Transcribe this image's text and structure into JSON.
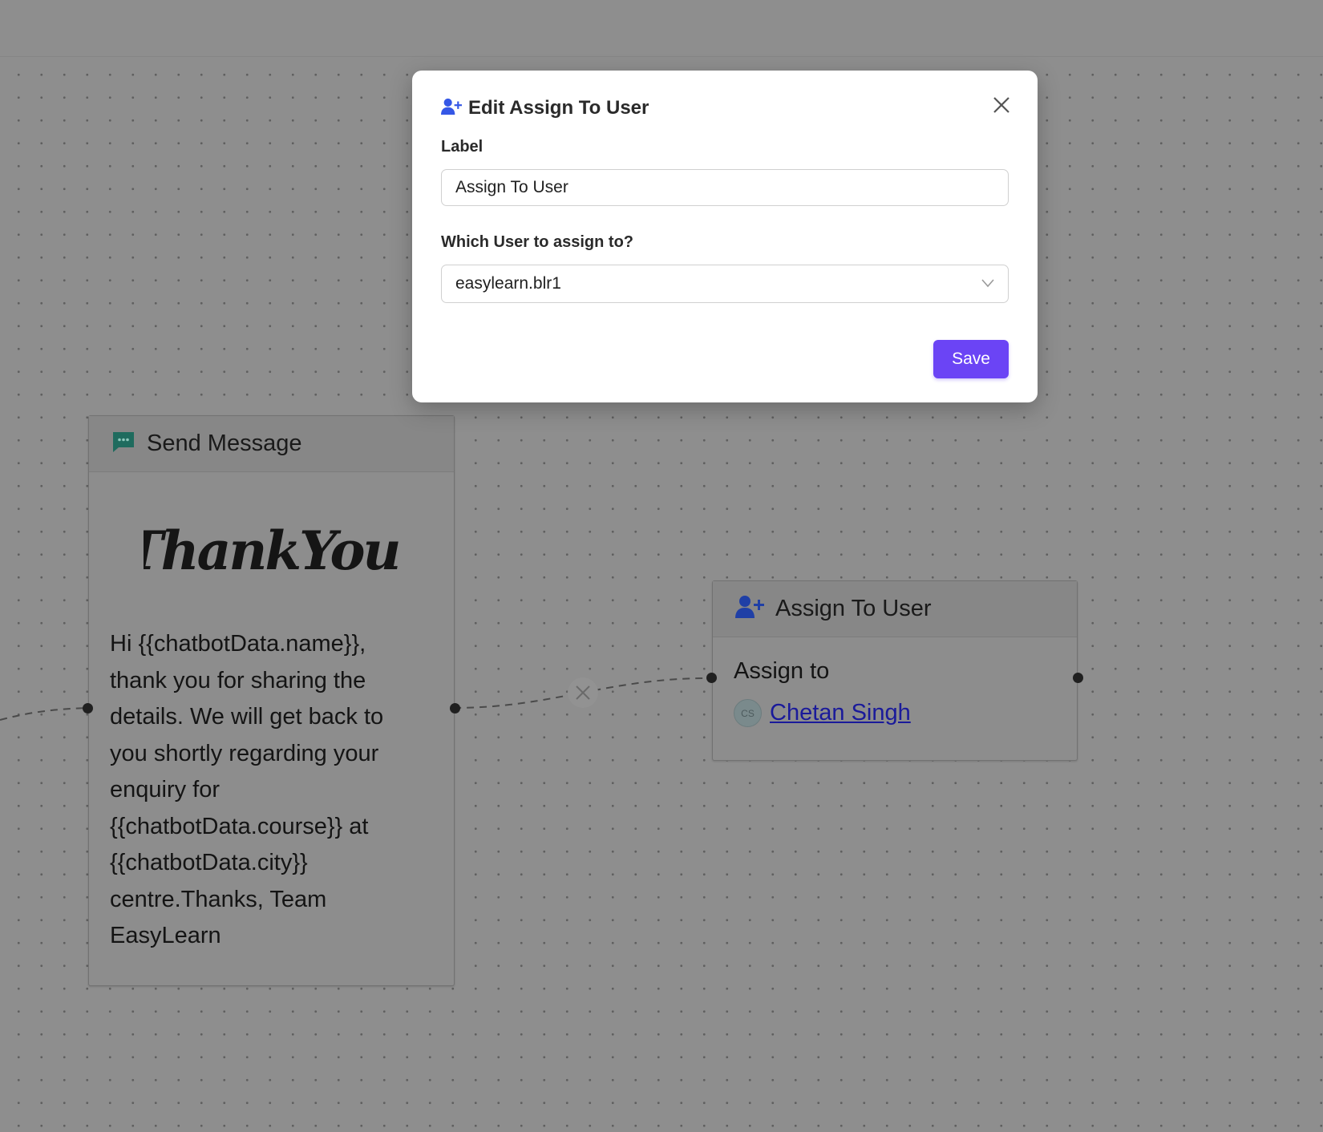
{
  "modal": {
    "title": "Edit Assign To User",
    "title_icon": "user-plus-icon",
    "label_field": {
      "label": "Label",
      "value": "Assign To User"
    },
    "user_field": {
      "label": "Which User to assign to?",
      "selected": "easylearn.blr1"
    },
    "save_label": "Save",
    "close_icon": "close-icon"
  },
  "send_message_node": {
    "title": "Send Message",
    "icon": "chat-bubble-icon",
    "image_text": "ThankYou!",
    "message": "Hi {{chatbotData.name}},\nthank you for sharing the\ndetails. We will get back to\nyou shortly regarding your\nenquiry for\n{{chatbotData.course}} at\n{{chatbotData.city}}\ncentre.Thanks, Team\nEasyLearn"
  },
  "assign_node": {
    "title": "Assign To User",
    "icon": "user-plus-icon",
    "assign_label": "Assign to",
    "avatar_initials": "CS",
    "assignee_name": "Chetan Singh"
  },
  "colors": {
    "accent": "#6b44f5",
    "user_icon": "#3557e6",
    "chat_icon": "#1f6b5e",
    "overlay": "#8e8e8e",
    "link": "#1a1a9a"
  }
}
